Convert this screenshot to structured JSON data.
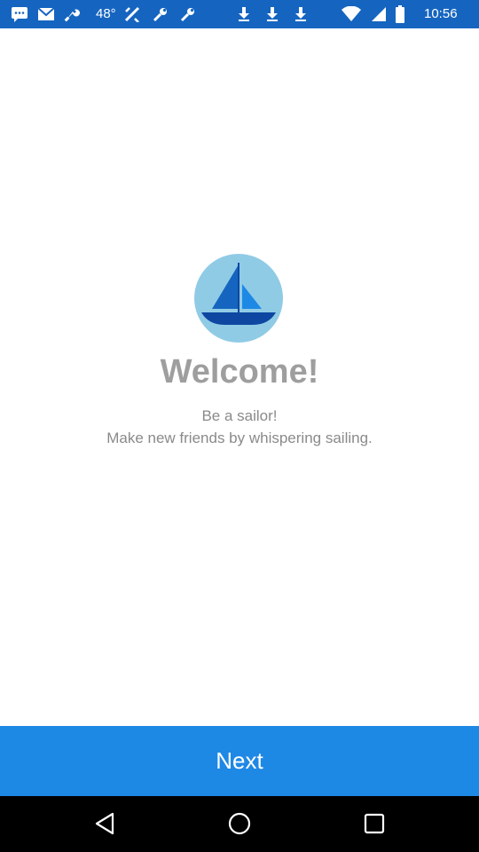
{
  "status_bar": {
    "time": "10:56",
    "signal_label": "48°",
    "icons": [
      "message-icon",
      "mail-icon",
      "wrench-icon",
      "signal-48-icon",
      "tool-icon",
      "wrench-icon",
      "download-icon",
      "download-icon",
      "download-icon",
      "wifi-icon",
      "cellular-icon",
      "battery-icon"
    ]
  },
  "main": {
    "welcome_title": "Welcome!",
    "subtitle_line1": "Be a sailor!",
    "subtitle_line2": "Make new friends by whispering sailing."
  },
  "footer": {
    "next_label": "Next"
  },
  "colors": {
    "status_bar": "#1565c0",
    "button": "#1e88e5",
    "logo_circle": "#90cbe6"
  }
}
